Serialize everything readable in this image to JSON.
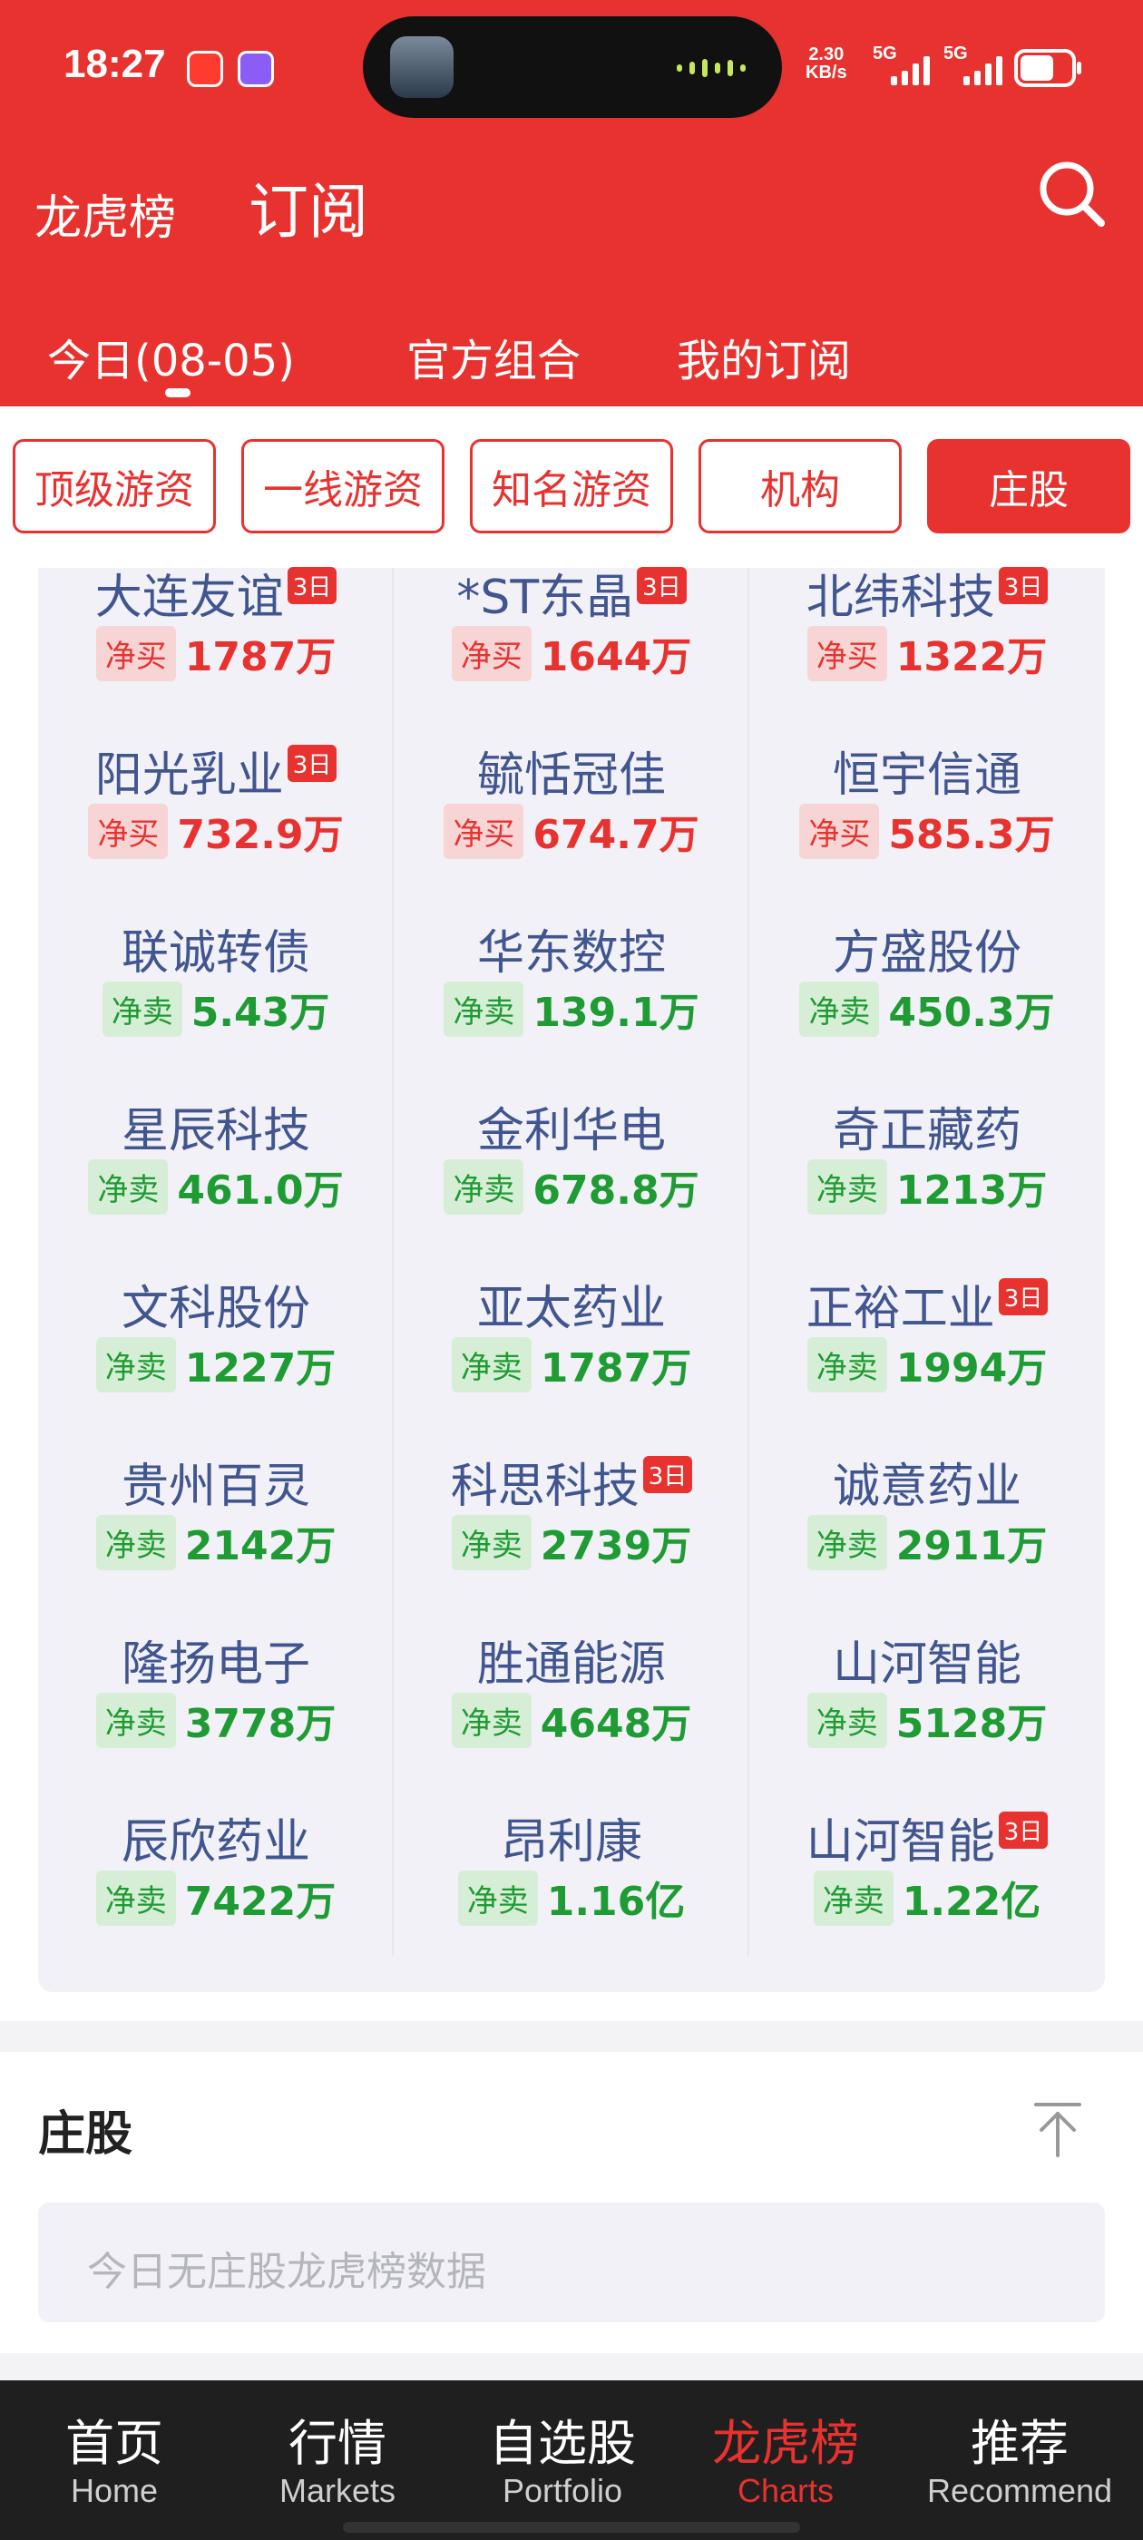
{
  "status_bar": {
    "time": "18:27",
    "net_speed": "2.30",
    "net_unit": "KB/s",
    "signal1": "5G",
    "signal2": "5G"
  },
  "header": {
    "title_small": "龙虎榜",
    "title_main": "订阅",
    "tabs": [
      {
        "label": "今日(08-05)"
      },
      {
        "label": "官方组合"
      },
      {
        "label": "我的订阅"
      }
    ]
  },
  "filters": [
    {
      "label": "顶级游资"
    },
    {
      "label": "一线游资"
    },
    {
      "label": "知名游资"
    },
    {
      "label": "机构"
    },
    {
      "label": "庄股"
    }
  ],
  "stocks": [
    {
      "name": "大连友谊",
      "tag": "3日",
      "type": "净买",
      "amount": "1787万"
    },
    {
      "name": "*ST东晶",
      "tag": "3日",
      "type": "净买",
      "amount": "1644万"
    },
    {
      "name": "北纬科技",
      "tag": "3日",
      "type": "净买",
      "amount": "1322万"
    },
    {
      "name": "阳光乳业",
      "tag": "3日",
      "type": "净买",
      "amount": "732.9万"
    },
    {
      "name": "毓恬冠佳",
      "tag": "",
      "type": "净买",
      "amount": "674.7万"
    },
    {
      "name": "恒宇信通",
      "tag": "",
      "type": "净买",
      "amount": "585.3万"
    },
    {
      "name": "联诚转债",
      "tag": "",
      "type": "净卖",
      "amount": "5.43万"
    },
    {
      "name": "华东数控",
      "tag": "",
      "type": "净卖",
      "amount": "139.1万"
    },
    {
      "name": "方盛股份",
      "tag": "",
      "type": "净卖",
      "amount": "450.3万"
    },
    {
      "name": "星辰科技",
      "tag": "",
      "type": "净卖",
      "amount": "461.0万"
    },
    {
      "name": "金利华电",
      "tag": "",
      "type": "净卖",
      "amount": "678.8万"
    },
    {
      "name": "奇正藏药",
      "tag": "",
      "type": "净卖",
      "amount": "1213万"
    },
    {
      "name": "文科股份",
      "tag": "",
      "type": "净卖",
      "amount": "1227万"
    },
    {
      "name": "亚太药业",
      "tag": "",
      "type": "净卖",
      "amount": "1787万"
    },
    {
      "name": "正裕工业",
      "tag": "3日",
      "type": "净卖",
      "amount": "1994万"
    },
    {
      "name": "贵州百灵",
      "tag": "",
      "type": "净卖",
      "amount": "2142万"
    },
    {
      "name": "科思科技",
      "tag": "3日",
      "type": "净卖",
      "amount": "2739万"
    },
    {
      "name": "诚意药业",
      "tag": "",
      "type": "净卖",
      "amount": "2911万"
    },
    {
      "name": "隆扬电子",
      "tag": "",
      "type": "净卖",
      "amount": "3778万"
    },
    {
      "name": "胜通能源",
      "tag": "",
      "type": "净卖",
      "amount": "4648万"
    },
    {
      "name": "山河智能",
      "tag": "",
      "type": "净卖",
      "amount": "5128万"
    },
    {
      "name": "辰欣药业",
      "tag": "",
      "type": "净卖",
      "amount": "7422万"
    },
    {
      "name": "昂利康",
      "tag": "",
      "type": "净卖",
      "amount": "1.16亿"
    },
    {
      "name": "山河智能",
      "tag": "3日",
      "type": "净卖",
      "amount": "1.22亿"
    }
  ],
  "section": {
    "title": "庄股",
    "empty_text": "今日无庄股龙虎榜数据"
  },
  "bottom_nav": [
    {
      "zh": "首页",
      "en": "Home"
    },
    {
      "zh": "行情",
      "en": "Markets"
    },
    {
      "zh": "自选股",
      "en": "Portfolio"
    },
    {
      "zh": "龙虎榜",
      "en": "Charts"
    },
    {
      "zh": "推荐",
      "en": "Recommend"
    }
  ],
  "colors": {
    "brand_red": "#e8322f",
    "buy_red": "#e8322f",
    "sell_green": "#1f9b33",
    "stock_name": "#41558e"
  }
}
